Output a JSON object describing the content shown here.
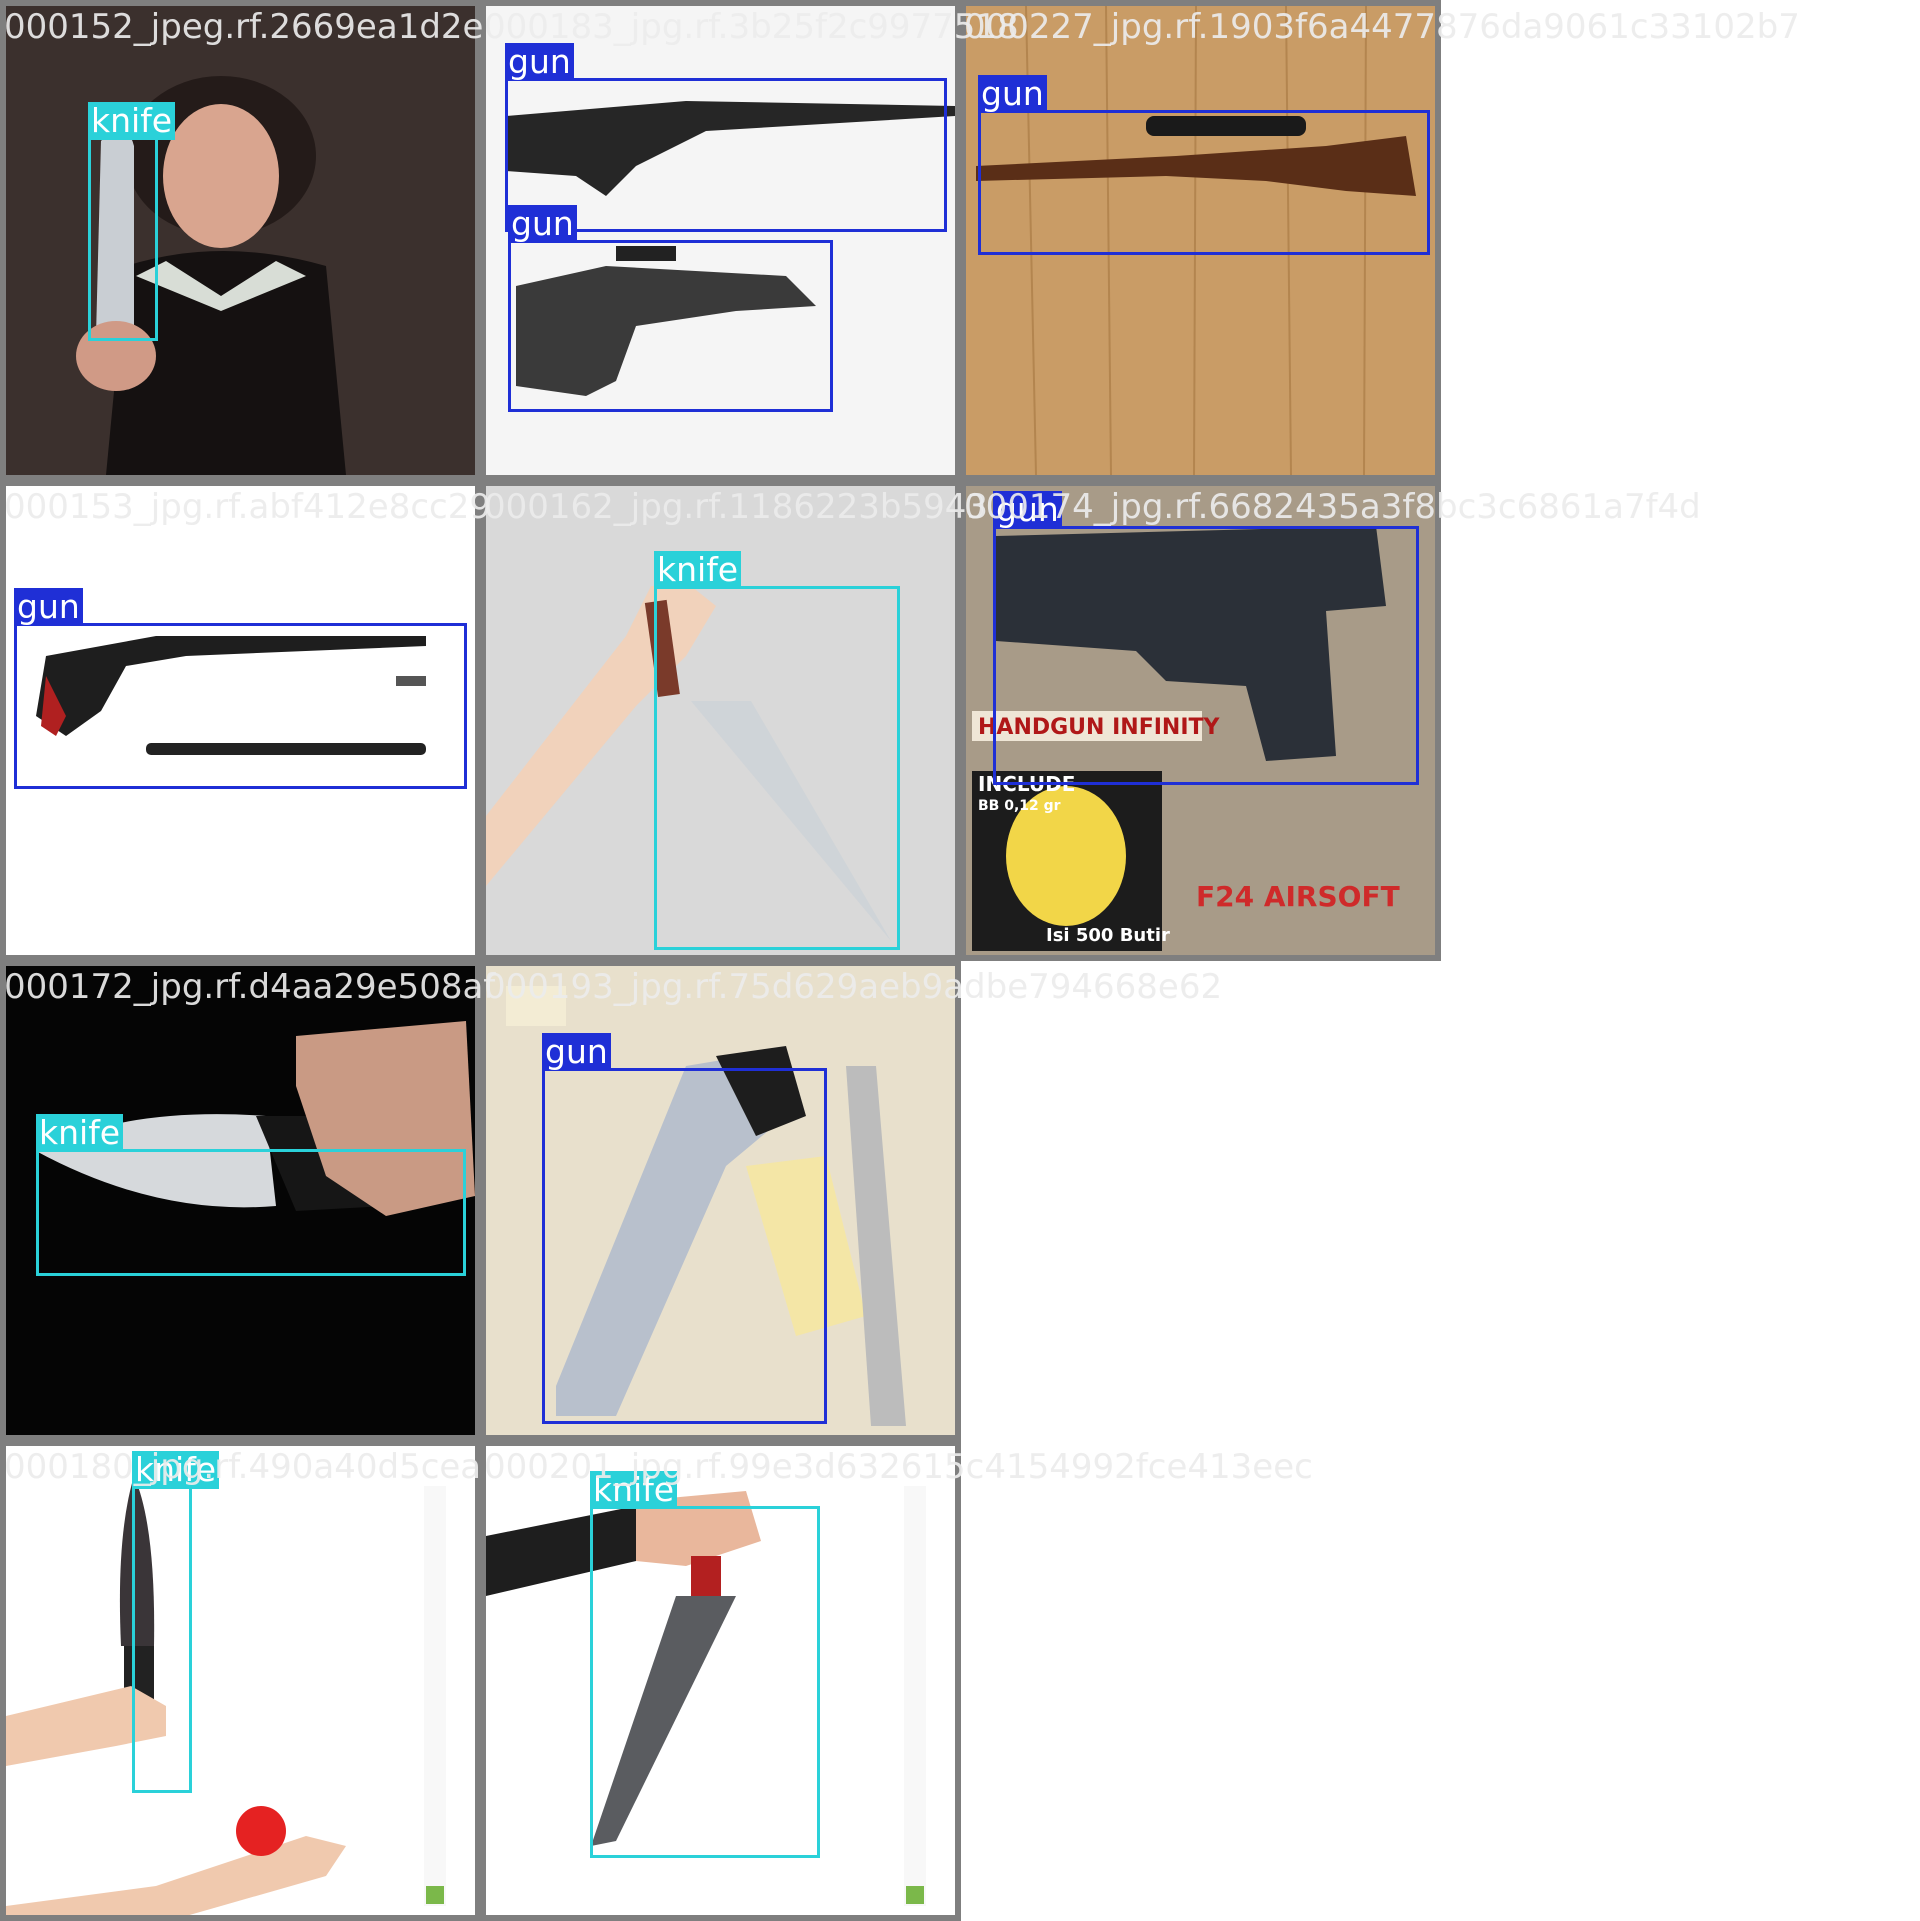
{
  "colors": {
    "gun": "#1f2fd6",
    "knife": "#2ad1d9",
    "tile_border": "#7f7f7f",
    "filename_text": "#ebebeb"
  },
  "tiles": [
    {
      "file": "000152_jpeg.rf.2669ea1d2e",
      "scene": "woman-holding-knife",
      "boxes": [
        {
          "label": "knife"
        }
      ]
    },
    {
      "file": "000183_jpg.rf.3b25f2c9977518",
      "scene": "two-rifles-white",
      "boxes": [
        {
          "label": "gun"
        },
        {
          "label": "gun"
        }
      ]
    },
    {
      "file": "000227_jpg.rf.1903f6a4477876da9061c33102b7",
      "scene": "rifle-on-wood",
      "boxes": [
        {
          "label": "gun"
        }
      ]
    },
    {
      "file": "000153_jpg.rf.abf412e8cc29",
      "scene": "pistol-parts-white",
      "boxes": [
        {
          "label": "gun"
        }
      ]
    },
    {
      "file": "000162_jpg.rf.1186223b5943",
      "scene": "arm-holding-knife",
      "boxes": [
        {
          "label": "knife"
        }
      ]
    },
    {
      "file": "000174_jpg.rf.6682435a3f8bc3c6861a7f4d",
      "scene": "airsoft-handgun",
      "boxes": [
        {
          "label": "gun"
        }
      ]
    },
    {
      "file": "000172_jpg.rf.d4aa29e508af",
      "scene": "hand-knife-black",
      "boxes": [
        {
          "label": "knife"
        }
      ]
    },
    {
      "file": "000193_jpg.rf.75d629aeb9adbe794668e62",
      "scene": "revolver-evidence",
      "boxes": [
        {
          "label": "gun"
        }
      ]
    },
    {
      "file": "000180_jpg.rf.490a40d5cea",
      "scene": "knife-and-tomato",
      "boxes": [
        {
          "label": "knife"
        }
      ]
    },
    {
      "file": "000201_jpg.rf.99e3d632615c4154992fce413eec",
      "scene": "fist-holding-knife",
      "boxes": [
        {
          "label": "knife"
        }
      ]
    }
  ]
}
